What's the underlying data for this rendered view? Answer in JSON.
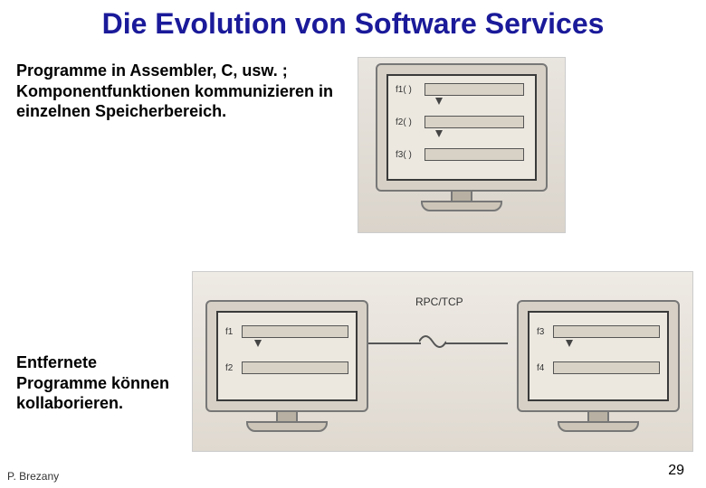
{
  "title": "Die Evolution von Software Services",
  "paragraph1": "Programme in Assembler, C, usw. ; Komponentfunktionen kommunizieren in einzelnen Speicherbereich.",
  "paragraph2": "Entfernete Programme können kollaborieren.",
  "figure1": {
    "functions": [
      "f1( )",
      "f2( )",
      "f3( )"
    ]
  },
  "figure2": {
    "left_functions": [
      "f1",
      "f2"
    ],
    "right_functions": [
      "f3",
      "f4"
    ],
    "connector_label": "RPC/TCP"
  },
  "footer": {
    "author": "P. Brezany",
    "page": "29"
  }
}
